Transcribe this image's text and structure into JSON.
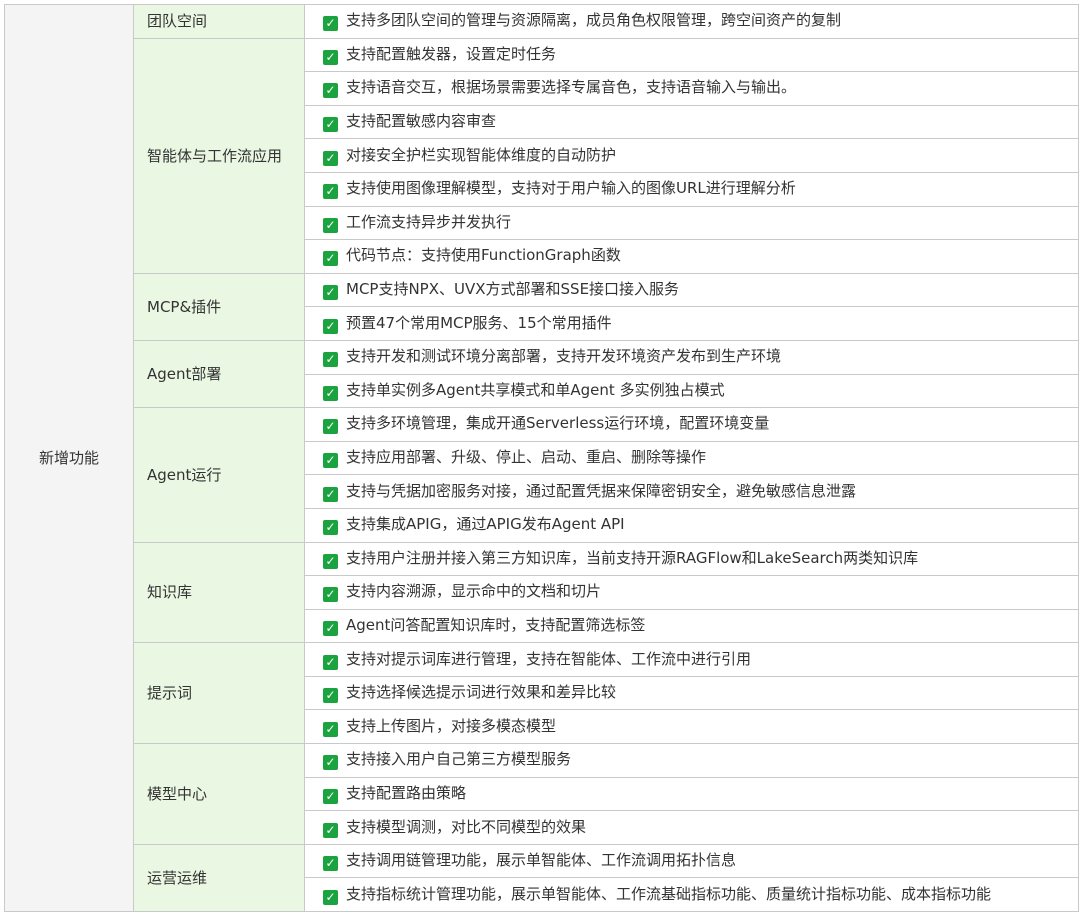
{
  "main_label": "新增功能",
  "icon": "check-square-icon",
  "colors": {
    "category_bg": "#eaf7e3",
    "main_bg": "#f4f4f4",
    "check": "#1aa33f",
    "border": "#c9c9c9"
  },
  "categories": [
    {
      "name": "团队空间",
      "features": [
        "支持多团队空间的管理与资源隔离，成员角色权限管理，跨空间资产的复制"
      ]
    },
    {
      "name": "智能体与工作流应用",
      "features": [
        "支持配置触发器，设置定时任务",
        "支持语音交互，根据场景需要选择专属音色，支持语音输入与输出。",
        "支持配置敏感内容审查",
        "对接安全护栏实现智能体维度的自动防护",
        "支持使用图像理解模型，支持对于用户输入的图像URL进行理解分析",
        "工作流支持异步并发执行",
        "代码节点：支持使用FunctionGraph函数"
      ]
    },
    {
      "name": "MCP&插件",
      "features": [
        "MCP支持NPX、UVX方式部署和SSE接口接入服务",
        "预置47个常用MCP服务、15个常用插件"
      ]
    },
    {
      "name": "Agent部署",
      "features": [
        "支持开发和测试环境分离部署，支持开发环境资产发布到生产环境",
        "支持单实例多Agent共享模式和单Agent 多实例独占模式"
      ]
    },
    {
      "name": "Agent运行",
      "features": [
        "支持多环境管理，集成开通Serverless运行环境，配置环境变量",
        "支持应用部署、升级、停止、启动、重启、删除等操作",
        "支持与凭据加密服务对接，通过配置凭据来保障密钥安全，避免敏感信息泄露",
        "支持集成APIG，通过APIG发布Agent API"
      ]
    },
    {
      "name": "知识库",
      "features": [
        "支持用户注册并接入第三方知识库，当前支持开源RAGFlow和LakeSearch两类知识库",
        "支持内容溯源，显示命中的文档和切片",
        "Agent问答配置知识库时，支持配置筛选标签"
      ]
    },
    {
      "name": "提示词",
      "features": [
        "支持对提示词库进行管理，支持在智能体、工作流中进行引用",
        "支持选择候选提示词进行效果和差异比较",
        "支持上传图片，对接多模态模型"
      ]
    },
    {
      "name": "模型中心",
      "features": [
        "支持接入用户自己第三方模型服务",
        "支持配置路由策略",
        "支持模型调测，对比不同模型的效果"
      ]
    },
    {
      "name": "运营运维",
      "features": [
        "支持调用链管理功能，展示单智能体、工作流调用拓扑信息",
        "支持指标统计管理功能，展示单智能体、工作流基础指标功能、质量统计指标功能、成本指标功能"
      ]
    }
  ]
}
